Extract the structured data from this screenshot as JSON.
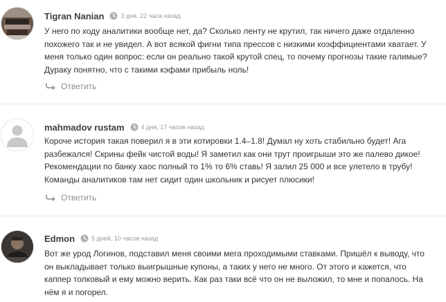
{
  "colors": {
    "text": "#333333",
    "meta": "#9a9a9a",
    "reply": "#8d8d8d",
    "divider": "#ebebeb",
    "author": "#3a3f44"
  },
  "comments": [
    {
      "author": "Tigran Nanian",
      "time": "3 дня, 22 часа назад",
      "lines": [
        "У него по ходу аналитики вообще нет, да? Сколько ленту не крутил, так ничего даже отдаленно",
        "похожего так и не увидел. А вот всякой фигни типа прессов с низкими коэффициентами хватает. У",
        "меня только один вопрос: если он реально такой крутой спец, то почему прогнозы такие галимые?",
        "Дураку понятно, что с такими кэфами прибыль ноль!"
      ],
      "reply_label": "Ответить",
      "avatar_icon": "avatar-photo-icon"
    },
    {
      "author": "mahmadov rustam",
      "time": "4 дня, 17 часов назад",
      "lines": [
        "Короче история такая поверил я в эти котировки 1.4–1.8! Думал ну хоть стабильно будет! Ага",
        "разбежался! Скрины фейк чистой воды! Я заметил как они трут проигрыши это же палево дикое!",
        "Рекомендации по банку хаос полный то 1% то 6% ставь! Я залил 25 000 и все улетело в трубу!",
        "Команды аналитиков там нет сидит один школьник и рисует плюсики!"
      ],
      "reply_label": "Ответить",
      "avatar_icon": "default-user-avatar-icon"
    },
    {
      "author": "Edmon",
      "time": "5 дней, 10 часов назад",
      "lines": [
        "Вот же урод Логинов, подставил меня своими мега проходимыми ставками. Пришёл к выводу, что",
        "он выкладывает только выигрышные купоны, а таких у него не много. От этого и кажется, что",
        "каппер толковый и ему можно верить. Как раз таки всё что он не выложил, то мне и попалось. На",
        "нём я и погорел."
      ],
      "avatar_icon": "avatar-photo-icon"
    }
  ]
}
